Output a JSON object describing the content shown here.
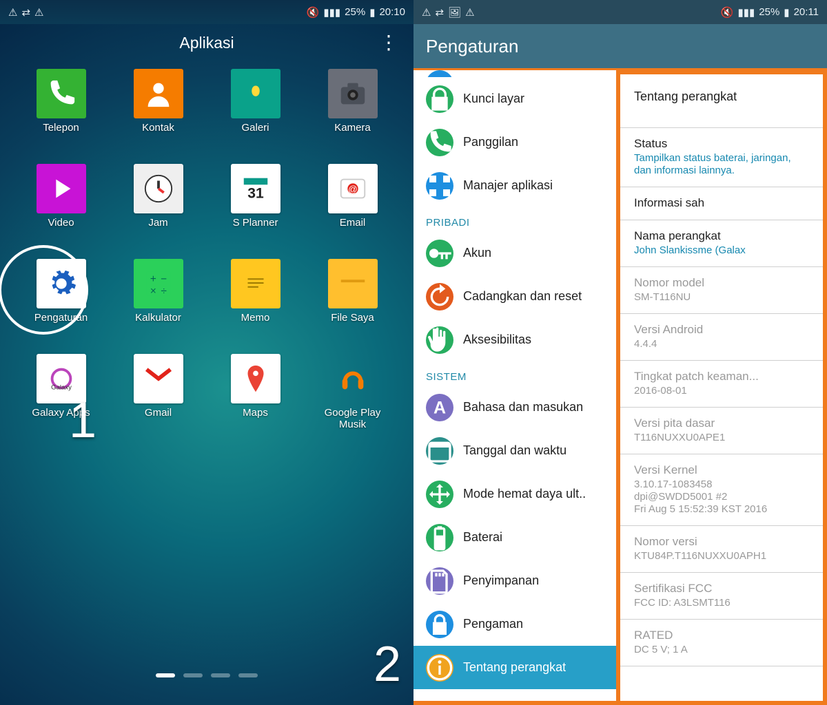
{
  "pane1": {
    "status": {
      "battery": "25%",
      "time": "20:10"
    },
    "title": "Aplikasi",
    "apps": [
      {
        "label": "Telepon",
        "bg": "#34b233"
      },
      {
        "label": "Kontak",
        "bg": "#f57c00"
      },
      {
        "label": "Galeri",
        "bg": "#0aa28a"
      },
      {
        "label": "Kamera",
        "bg": "#6a6e78"
      },
      {
        "label": "Video",
        "bg": "#c813d6"
      },
      {
        "label": "Jam",
        "bg": "#efefef"
      },
      {
        "label": "S Planner",
        "bg": "#ffffff"
      },
      {
        "label": "Email",
        "bg": "#ffffff"
      },
      {
        "label": "Pengaturan",
        "bg": "#ffffff",
        "highlight": true
      },
      {
        "label": "Kalkulator",
        "bg": "#2bd05a"
      },
      {
        "label": "Memo",
        "bg": "#ffc720"
      },
      {
        "label": "File Saya",
        "bg": "#ffbf2e"
      },
      {
        "label": "Galaxy Apps",
        "bg": "#ffffff"
      },
      {
        "label": "Gmail",
        "bg": "#ffffff"
      },
      {
        "label": "Maps",
        "bg": "#ffffff"
      },
      {
        "label": "Google Play\nMusik",
        "bg": "transparent"
      }
    ],
    "step1": "1",
    "step2": "2"
  },
  "pane2": {
    "status": {
      "battery": "25%",
      "time": "20:11"
    },
    "title": "Pengaturan",
    "left": {
      "items1": [
        {
          "label": "Kunci layar",
          "icon": "lock",
          "bg": "#27ae60"
        },
        {
          "label": "Panggilan",
          "icon": "phone",
          "bg": "#27ae60"
        },
        {
          "label": "Manajer aplikasi",
          "icon": "grid",
          "bg": "#1e8fe0"
        }
      ],
      "header1": "PRIBADI",
      "items2": [
        {
          "label": "Akun",
          "icon": "key",
          "bg": "#27ae60"
        },
        {
          "label": "Cadangkan dan reset",
          "icon": "reset",
          "bg": "#e35a1d"
        },
        {
          "label": "Aksesibilitas",
          "icon": "hand",
          "bg": "#27ae60"
        }
      ],
      "header2": "SISTEM",
      "items3": [
        {
          "label": "Bahasa dan masukan",
          "icon": "lang",
          "bg": "#7b6fc2"
        },
        {
          "label": "Tanggal dan waktu",
          "icon": "date",
          "bg": "#2a8f8b"
        },
        {
          "label": "Mode hemat daya ult..",
          "icon": "save",
          "bg": "#27ae60"
        },
        {
          "label": "Baterai",
          "icon": "batt",
          "bg": "#27ae60"
        },
        {
          "label": "Penyimpanan",
          "icon": "sd",
          "bg": "#7b6fc2"
        },
        {
          "label": "Pengaman",
          "icon": "lock2",
          "bg": "#1e8fe0"
        }
      ],
      "selected": {
        "label": "Tentang perangkat",
        "icon": "info",
        "bg": "#f0a31f"
      }
    },
    "right": {
      "title": "Tentang perangkat",
      "items": [
        {
          "label": "Status",
          "value": "Tampilkan status baterai, jaringan, dan informasi lainnya.",
          "dim": false
        },
        {
          "label": "Informasi sah",
          "value": "",
          "dim": false
        },
        {
          "label": "Nama perangkat",
          "value": "John Slankissme (Galax",
          "dim": false
        },
        {
          "label": "Nomor model",
          "value": "SM-T116NU",
          "dim": true
        },
        {
          "label": "Versi Android",
          "value": "4.4.4",
          "dim": true
        },
        {
          "label": "Tingkat patch keaman...",
          "value": "2016-08-01",
          "dim": true
        },
        {
          "label": "Versi pita dasar",
          "value": "T116NUXXU0APE1",
          "dim": true
        },
        {
          "label": "Versi Kernel",
          "value": "3.10.17-1083458\ndpi@SWDD5001 #2\nFri Aug 5 15:52:39 KST 2016",
          "dim": true
        },
        {
          "label": "Nomor versi",
          "value": "KTU84P.T116NUXXU0APH1",
          "dim": true
        },
        {
          "label": "Sertifikasi FCC",
          "value": "FCC ID: A3LSMT116",
          "dim": true
        },
        {
          "label": "RATED",
          "value": "DC 5 V; 1 A",
          "dim": true
        }
      ]
    }
  }
}
